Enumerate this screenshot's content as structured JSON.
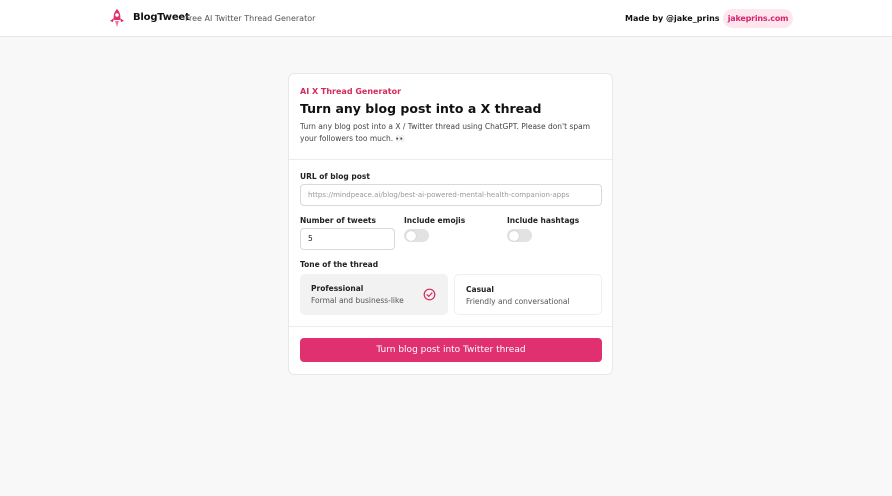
{
  "header": {
    "brand": "BlogTweet",
    "tagline": "Free AI Twitter Thread Generator",
    "made_by": "Made by @jake_prins",
    "site_link": "jakeprins.com"
  },
  "card": {
    "eyebrow": "AI X Thread Generator",
    "title": "Turn any blog post into a X thread",
    "description": "Turn any blog post into a X / Twitter thread using ChatGPT. Please don't spam your followers too much. 👀",
    "url_label": "URL of blog post",
    "url_placeholder": "https://mindpeace.ai/blog/best-ai-powered-mental-health-companion-apps",
    "tweets_label": "Number of tweets",
    "tweets_value": "5",
    "emojis_label": "Include emojis",
    "emojis_on": false,
    "hashtags_label": "Include hashtags",
    "hashtags_on": false,
    "tone_label": "Tone of the thread",
    "tones": [
      {
        "title": "Professional",
        "subtitle": "Formal and business-like",
        "selected": true
      },
      {
        "title": "Casual",
        "subtitle": "Friendly and conversational",
        "selected": false
      }
    ],
    "submit_label": "Turn blog post into Twitter thread"
  },
  "colors": {
    "accent": "#e0306f",
    "eyebrow": "#d42a5c",
    "pill_bg": "#fde6ee",
    "check": "#d42a5c"
  },
  "icons": {
    "logo": "rocket-logo-icon",
    "tone_selected": "check-circle-icon"
  }
}
